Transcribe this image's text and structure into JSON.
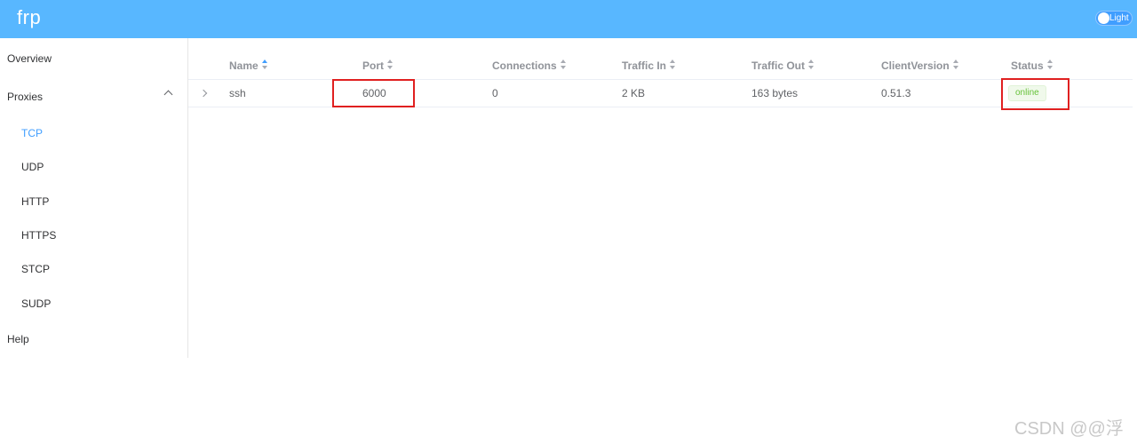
{
  "header": {
    "logo": "frp",
    "theme_toggle_label": "Light",
    "colors": {
      "header_bg": "#58b7ff",
      "accent": "#409eff"
    }
  },
  "sidebar": {
    "overview": "Overview",
    "proxies": "Proxies",
    "proxy_types": [
      "TCP",
      "UDP",
      "HTTP",
      "HTTPS",
      "STCP",
      "SUDP"
    ],
    "active_item": "TCP",
    "help": "Help"
  },
  "table": {
    "columns": [
      "Name",
      "Port",
      "Connections",
      "Traffic In",
      "Traffic Out",
      "ClientVersion",
      "Status"
    ],
    "sorted_column": "Name",
    "rows": [
      {
        "name": "ssh",
        "port": "6000",
        "connections": "0",
        "traffic_in": "2 KB",
        "traffic_out": "163 bytes",
        "client_version": "0.51.3",
        "status": "online"
      }
    ],
    "status_color": "#67c23a"
  },
  "annotation_color": "#e02020",
  "watermark": "CSDN @@浮"
}
